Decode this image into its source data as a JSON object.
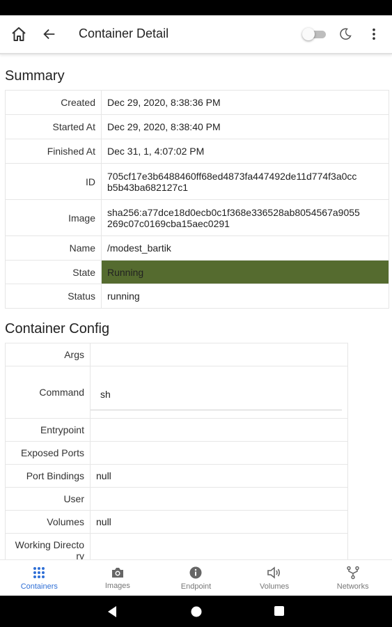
{
  "app": {
    "title": "Container Detail"
  },
  "summary": {
    "heading": "Summary",
    "rows": [
      {
        "key": "Created",
        "value": "Dec 29, 2020, 8:38:36 PM"
      },
      {
        "key": "Started At",
        "value": "Dec 29, 2020, 8:38:40 PM"
      },
      {
        "key": "Finished At",
        "value": "Dec 31, 1, 4:07:02 PM"
      },
      {
        "key": "ID",
        "value": "705cf17e3b6488460ff68ed4873fa447492de11d774f3a0cc",
        "value2": "b5b43ba682127c1"
      },
      {
        "key": "Image",
        "value": "sha256:a77dce18d0ecb0c1f368e336528ab8054567a9055",
        "value2": "269c07c0169cba15aec0291"
      },
      {
        "key": "Name",
        "value": "/modest_bartik"
      },
      {
        "key": "State",
        "value": "Running"
      },
      {
        "key": "Status",
        "value": "running"
      }
    ]
  },
  "config": {
    "heading": "Container Config",
    "rows": [
      {
        "key": "Args",
        "value": ""
      },
      {
        "key": "Command",
        "value": "sh"
      },
      {
        "key": "Entrypoint",
        "value": ""
      },
      {
        "key": "Exposed Ports",
        "value": ""
      },
      {
        "key": "Port Bindings",
        "value": "null"
      },
      {
        "key": "User",
        "value": ""
      },
      {
        "key": "Volumes",
        "value": "null"
      },
      {
        "key": "Working Directo",
        "key2": "ry",
        "value": ""
      }
    ]
  },
  "nav": {
    "items": [
      {
        "label": "Containers",
        "icon": "grid-icon",
        "active": true
      },
      {
        "label": "Images",
        "icon": "camera-icon",
        "active": false
      },
      {
        "label": "Endpoint",
        "icon": "info-icon",
        "active": false
      },
      {
        "label": "Volumes",
        "icon": "speaker-icon",
        "active": false
      },
      {
        "label": "Networks",
        "icon": "network-fork-icon",
        "active": false
      }
    ]
  },
  "colors": {
    "accent": "#2f6fd6",
    "link": "#3f4fd1",
    "running": "#556b2f"
  }
}
